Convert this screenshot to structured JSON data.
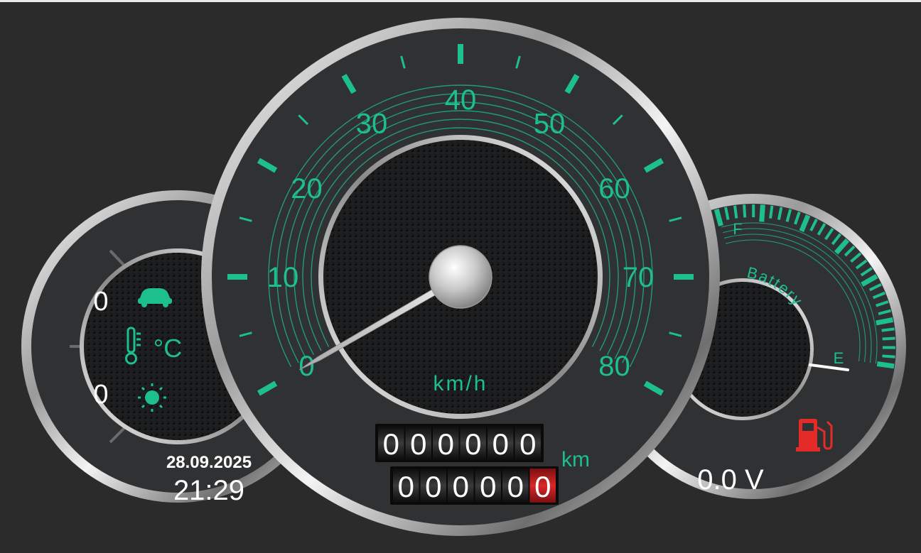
{
  "colors": {
    "accent": "#1dbf8c",
    "dial_bg": "#303132",
    "bezel_light": "#f2f2f2",
    "bezel_dark": "#7d7d7d",
    "warning": "#e52a2a",
    "text": "#ffffff",
    "fuel_needle": "#ffffff"
  },
  "speedometer": {
    "unit": "km/h",
    "scale_labels": [
      "0",
      "10",
      "20",
      "30",
      "40",
      "50",
      "60",
      "70",
      "80"
    ],
    "scale_min": 0,
    "scale_max": 80,
    "current_speed": 0
  },
  "odometer": {
    "total_digits": [
      "0",
      "0",
      "0",
      "0",
      "0",
      "0"
    ],
    "trip_digits": [
      "0",
      "0",
      "0",
      "0",
      "0"
    ],
    "trip_last_digit": "0",
    "unit": "km"
  },
  "left_gauge": {
    "top_value": "0",
    "bottom_value": "0",
    "temp_unit": "°C",
    "date": "28.09.2025",
    "time": "21:29",
    "icons": [
      "car-icon",
      "thermometer-icon",
      "sun-icon"
    ]
  },
  "battery_gauge": {
    "label": "Battery",
    "full_mark": "F",
    "empty_mark": "E",
    "voltage": "0.0 V",
    "level": 0,
    "icon": "fuel-pump-icon"
  }
}
